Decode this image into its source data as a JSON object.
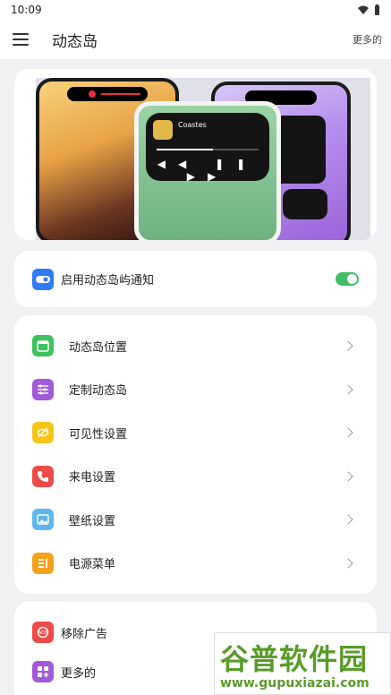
{
  "status": {
    "time": "10:09"
  },
  "appbar": {
    "title": "动态岛",
    "more": "更多的"
  },
  "banner": {
    "song": "Coastes"
  },
  "toggle": {
    "label": "启用动态岛屿通知",
    "enabled": true,
    "color": "#3fbf63"
  },
  "settings": {
    "items": [
      {
        "label": "动态岛位置",
        "icon": "calendar-icon",
        "color": "#3dc35a"
      },
      {
        "label": "定制动态岛",
        "icon": "sliders-icon",
        "color": "#a25ad8"
      },
      {
        "label": "可见性设置",
        "icon": "eye-off-icon",
        "color": "#f5c518"
      },
      {
        "label": "来电设置",
        "icon": "phone-icon",
        "color": "#ef4a4a"
      },
      {
        "label": "壁纸设置",
        "icon": "image-icon",
        "color": "#5db7ef"
      },
      {
        "label": "电源菜单",
        "icon": "power-menu-icon",
        "color": "#f4a21c"
      }
    ]
  },
  "bottom": {
    "items": [
      {
        "label": "移除广告",
        "icon": "remove-ads-icon",
        "color": "#ef4a4a"
      },
      {
        "label": "更多的",
        "icon": "apps-icon",
        "color": "#a25ad8"
      }
    ]
  },
  "watermark": {
    "line1": "谷普软件园",
    "line2": "www.gupuxiazai.com"
  }
}
